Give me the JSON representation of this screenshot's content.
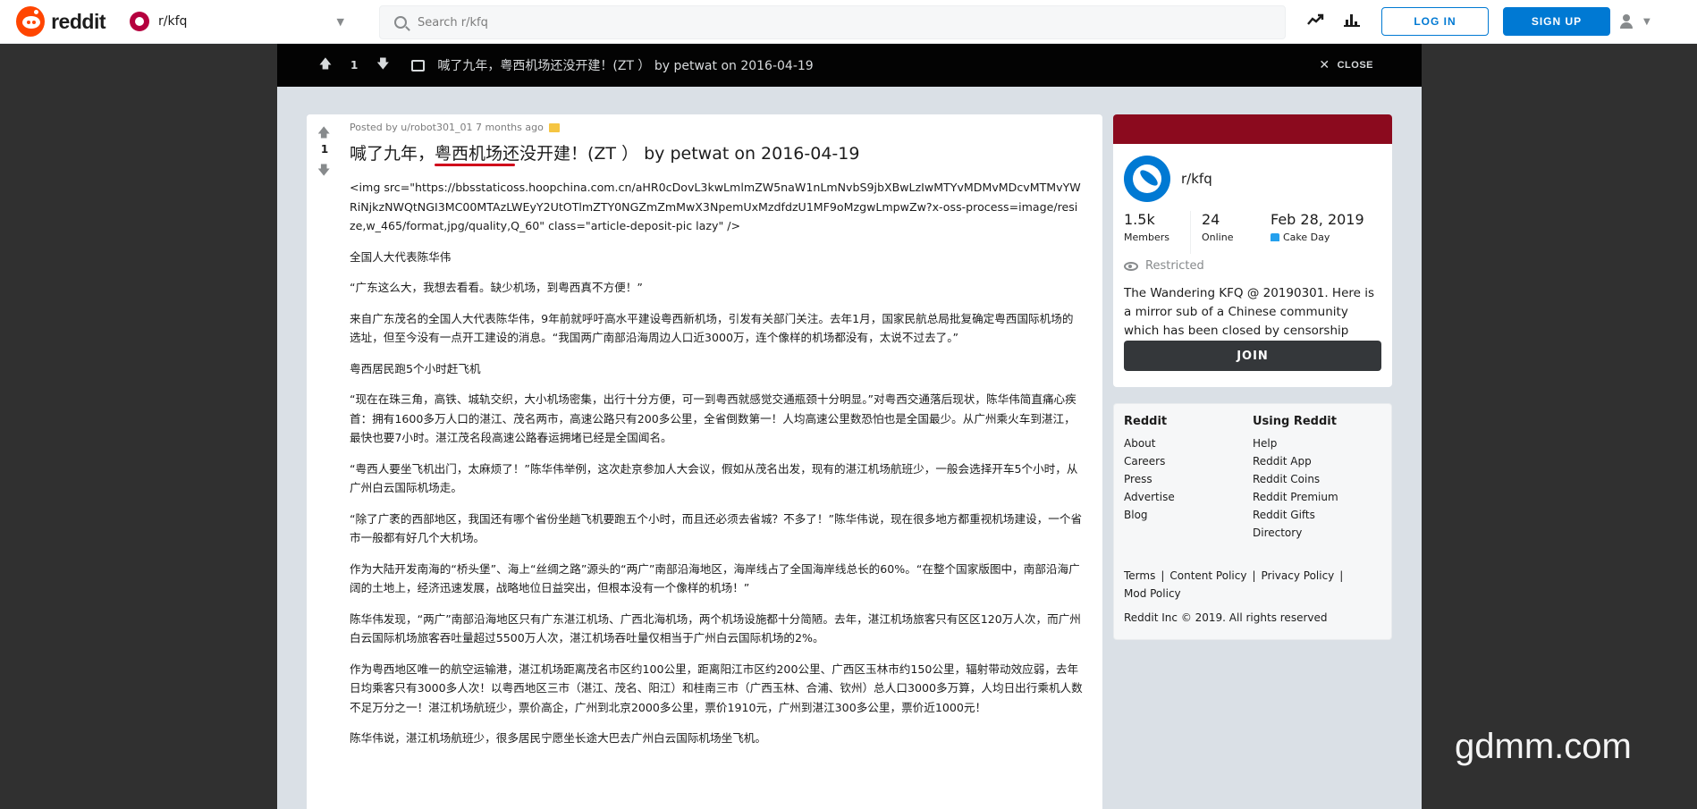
{
  "header": {
    "logo_text": "reddit",
    "subreddit": "r/kfq",
    "search_placeholder": "Search r/kfq",
    "login_label": "LOG IN",
    "signup_label": "SIGN UP"
  },
  "overlay": {
    "vote_count": "1",
    "title": "喊了九年，粤西机场还没开建！(ZT ） by petwat on 2016-04-19",
    "close_label": "CLOSE"
  },
  "post": {
    "posted_by": "Posted by u/robot301_01 7 months ago",
    "vote_count": "1",
    "title": "喊了九年，粤西机场还没开建！(ZT ） by petwat on 2016-04-19",
    "paragraphs": [
      "<img src=\"https://bbsstaticoss.hoopchina.com.cn/aHR0cDovL3kwLmlmZW5naW1nLmNvbS9jbXBwLzIwMTYvMDMvMDcvMTMvYWRiNjkzNWQtNGI3MC00MTAzLWEyY2UtOTlmZTY0NGZmZmMwX3NpemUxMzdfdzU1MF9oMzgwLmpwZw?x-oss-process=image/resize,w_465/format,jpg/quality,Q_60\" class=\"article-deposit-pic lazy\" />",
      "全国人大代表陈华伟",
      "“广东这么大，我想去看看。缺少机场，到粤西真不方便！”",
      "来自广东茂名的全国人大代表陈华伟，9年前就呼吁高水平建设粤西新机场，引发有关部门关注。去年1月，国家民航总局批复确定粤西国际机场的选址，但至今没有一点开工建设的消息。“我国两广南部沿海周边人口近3000万，连个像样的机场都没有，太说不过去了。”",
      "粤西居民跑5个小时赶飞机",
      "“现在在珠三角，高铁、城轨交织，大小机场密集，出行十分方便，可一到粤西就感觉交通瓶颈十分明显。”对粤西交通落后现状，陈华伟简直痛心疾首：拥有1600多万人口的湛江、茂名两市，高速公路只有200多公里，全省倒数第一！人均高速公里数恐怕也是全国最少。从广州乘火车到湛江，最快也要7小时。湛江茂名段高速公路春运拥堵已经是全国闻名。",
      "“粤西人要坐飞机出门，太麻烦了！”陈华伟举例，这次赴京参加人大会议，假如从茂名出发，现有的湛江机场航班少，一般会选择开车5个小时，从广州白云国际机场走。",
      "“除了广袤的西部地区，我国还有哪个省份坐趟飞机要跑五个小时，而且还必须去省城？不多了！”陈华伟说，现在很多地方都重视机场建设，一个省市一般都有好几个大机场。",
      "作为大陆开发南海的“桥头堡”、海上“丝绸之路”源头的“两广”南部沿海地区，海岸线占了全国海岸线总长的60%。“在整个国家版图中，南部沿海广阔的土地上，经济迅速发展，战略地位日益突出，但根本没有一个像样的机场！”",
      "陈华伟发现，“两广”南部沿海地区只有广东湛江机场、广西北海机场，两个机场设施都十分简陋。去年，湛江机场旅客只有区区120万人次，而广州白云国际机场旅客吞吐量超过5500万人次，湛江机场吞吐量仅相当于广州白云国际机场的2%。",
      "作为粤西地区唯一的航空运输港，湛江机场距离茂名市区约100公里，距离阳江市区约200公里、广西区玉林市约150公里，辐射带动效应弱，去年日均乘客只有3000多人次！以粤西地区三市（湛江、茂名、阳江）和桂南三市（广西玉林、合浦、钦州）总人口3000多万算，人均日出行乘机人数不足万分之一！湛江机场航班少，票价高企，广州到北京2000多公里，票价1910元，广州到湛江300多公里，票价近1000元！",
      "陈华伟说，湛江机场航班少，很多居民宁愿坐长途大巴去广州白云国际机场坐飞机。"
    ]
  },
  "sidebar": {
    "community_name": "r/kfq",
    "members_count": "1.5k",
    "members_label": "Members",
    "online_count": "24",
    "online_label": "Online",
    "cake_date": "Feb 28, 2019",
    "cake_label": "Cake Day",
    "restricted_label": "Restricted",
    "description": "The Wandering KFQ @ 20190301. Here is a mirror sub of a Chinese community which has been closed by censorship problem.",
    "join_label": "JOIN"
  },
  "footer": {
    "col1_title": "Reddit",
    "col1_links": [
      "About",
      "Careers",
      "Press",
      "Advertise",
      "Blog"
    ],
    "col2_title": "Using Reddit",
    "col2_links": [
      "Help",
      "Reddit App",
      "Reddit Coins",
      "Reddit Premium",
      "Reddit Gifts",
      "Directory"
    ],
    "legal_links": [
      "Terms",
      "Content Policy",
      "Privacy Policy",
      "Mod Policy"
    ],
    "copyright": "Reddit Inc © 2019. All rights reserved"
  },
  "watermark": "gdmm.com",
  "colors": {
    "brand": "#ff4500",
    "accent": "#0079d3",
    "banner": "#8b0a1e",
    "underline": "#d0021b"
  },
  "icons": [
    "reddit-logo-icon",
    "subreddit-icon",
    "search-icon",
    "trending-icon",
    "stats-icon",
    "user-icon",
    "upvote-icon",
    "downvote-icon",
    "post-icon",
    "close-icon",
    "gold-award-icon",
    "cake-icon",
    "eye-icon"
  ]
}
